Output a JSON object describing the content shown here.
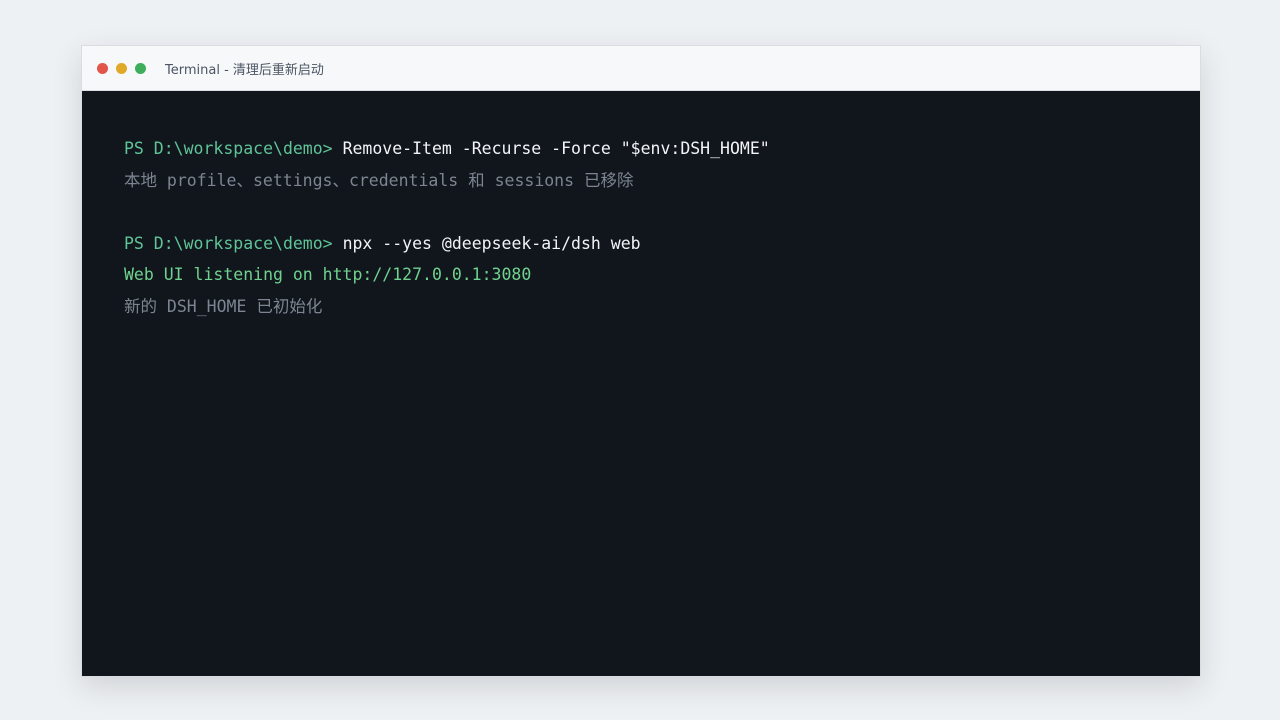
{
  "window": {
    "title": "Terminal - 清理后重新启动"
  },
  "terminal": {
    "lines": [
      {
        "type": "command",
        "prompt": "PS D:\\workspace\\demo>",
        "command": "Remove-Item -Recurse -Force \"$env:DSH_HOME\""
      },
      {
        "type": "output",
        "text": "本地 profile、settings、credentials 和 sessions 已移除"
      },
      {
        "type": "blank"
      },
      {
        "type": "command",
        "prompt": "PS D:\\workspace\\demo>",
        "command": "npx --yes @deepseek-ai/dsh web"
      },
      {
        "type": "success",
        "text": "Web UI listening on http://127.0.0.1:3080"
      },
      {
        "type": "output",
        "text": "新的 DSH_HOME 已初始化"
      }
    ]
  },
  "colors": {
    "prompt": "#5fc497",
    "command": "#f2f4f7",
    "muted_output": "#7c8591",
    "success_output": "#6fd28f",
    "terminal_bg": "#11151c"
  }
}
